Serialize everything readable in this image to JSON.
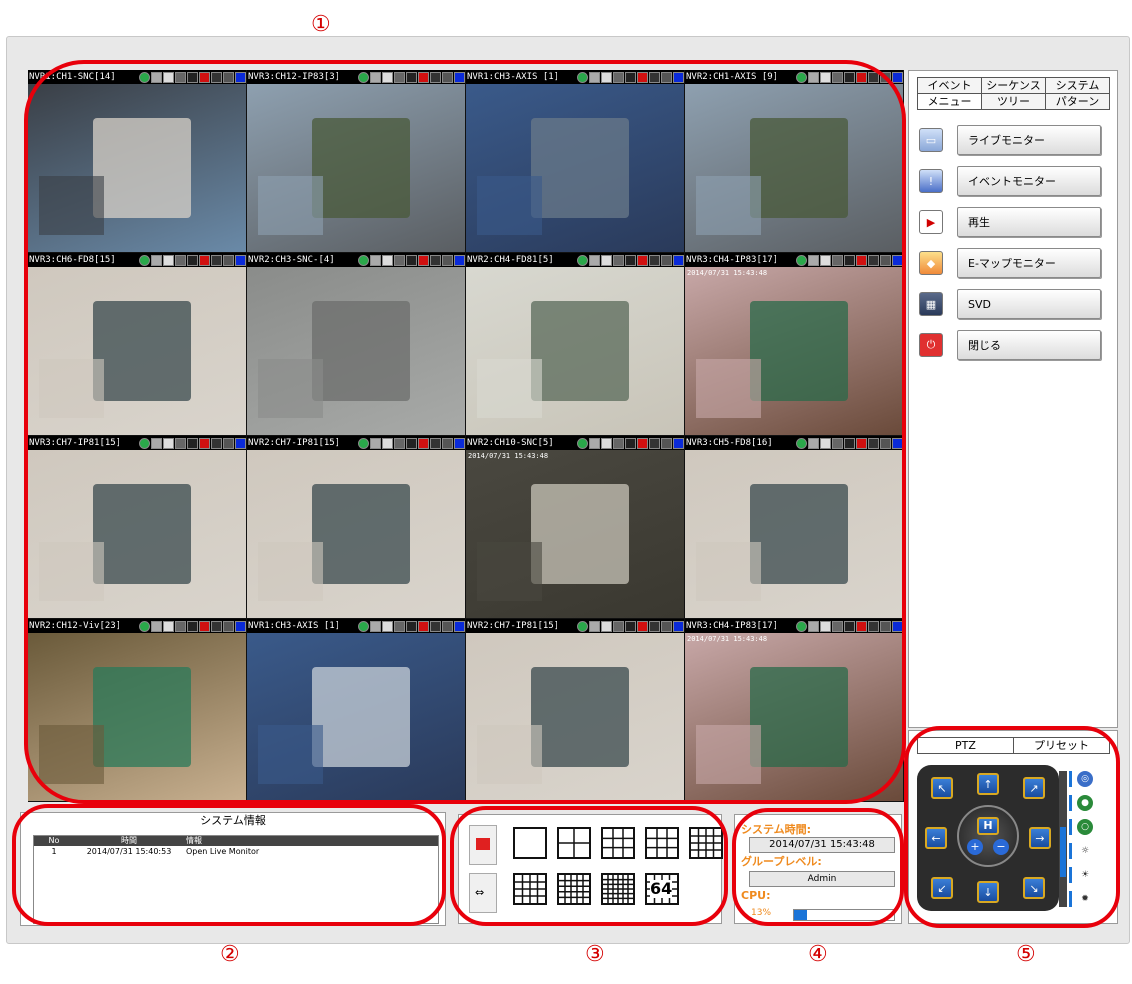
{
  "callouts": [
    "①",
    "②",
    "③",
    "④",
    "⑤"
  ],
  "cameras": [
    {
      "label": "NVR1:CH1-SNC[14]",
      "ts": ""
    },
    {
      "label": "NVR3:CH12-IP83[3]",
      "ts": ""
    },
    {
      "label": "NVR1:CH3-AXIS [1]",
      "ts": ""
    },
    {
      "label": "NVR2:CH1-AXIS [9]",
      "ts": ""
    },
    {
      "label": "NVR3:CH6-FD8[15]",
      "ts": ""
    },
    {
      "label": "NVR2:CH3-SNC-[4]",
      "ts": ""
    },
    {
      "label": "NVR2:CH4-FD81[5]",
      "ts": ""
    },
    {
      "label": "NVR3:CH4-IP83[17]",
      "ts": "2014/07/31 15:43:48"
    },
    {
      "label": "NVR3:CH7-IP81[15]",
      "ts": ""
    },
    {
      "label": "NVR2:CH7-IP81[15]",
      "ts": ""
    },
    {
      "label": "NVR2:CH10-SNC[5]",
      "ts": "2014/07/31 15:43:48"
    },
    {
      "label": "NVR3:CH5-FD8[16]",
      "ts": ""
    },
    {
      "label": "NVR2:CH12-Viv[23]",
      "ts": ""
    },
    {
      "label": "NVR1:CH3-AXIS [1]",
      "ts": ""
    },
    {
      "label": "NVR2:CH7-IP81[15]",
      "ts": ""
    },
    {
      "label": "NVR3:CH4-IP83[17]",
      "ts": "2014/07/31 15:43:48"
    }
  ],
  "right_panel": {
    "tabs_row1": [
      "イベント",
      "シーケンス",
      "システム"
    ],
    "tabs_row2": [
      "メニュー",
      "ツリー",
      "パターン"
    ],
    "menu": [
      {
        "label": "ライブモニター",
        "icon": "monitor-icon"
      },
      {
        "label": "イベントモニター",
        "icon": "alert-icon"
      },
      {
        "label": "再生",
        "icon": "play-icon"
      },
      {
        "label": "E-マップモニター",
        "icon": "map-icon"
      },
      {
        "label": "SVD",
        "icon": "svd-icon"
      },
      {
        "label": "閉じる",
        "icon": "power-icon"
      }
    ]
  },
  "system_info": {
    "title": "システム情報",
    "headers": [
      "No",
      "時間",
      "情報"
    ],
    "rows": [
      {
        "no": "1",
        "time": "2014/07/31 15:40:53",
        "info": "Open Live Monitor"
      }
    ]
  },
  "layouts": {
    "big_button": "64"
  },
  "status": {
    "time_label": "システム時間:",
    "time_value": "2014/07/31 15:43:48",
    "group_label": "グループレベル:",
    "group_value": "Admin",
    "cpu_label": "CPU:",
    "cpu_value": "13%",
    "cpu_fraction": 0.13
  },
  "ptz": {
    "tabs": [
      "PTZ",
      "プリセット"
    ],
    "center_label": "H"
  },
  "colors": {
    "highlight": "#e8000b",
    "orange_label": "#ef8a1e",
    "accent_blue": "#1a74d8"
  }
}
